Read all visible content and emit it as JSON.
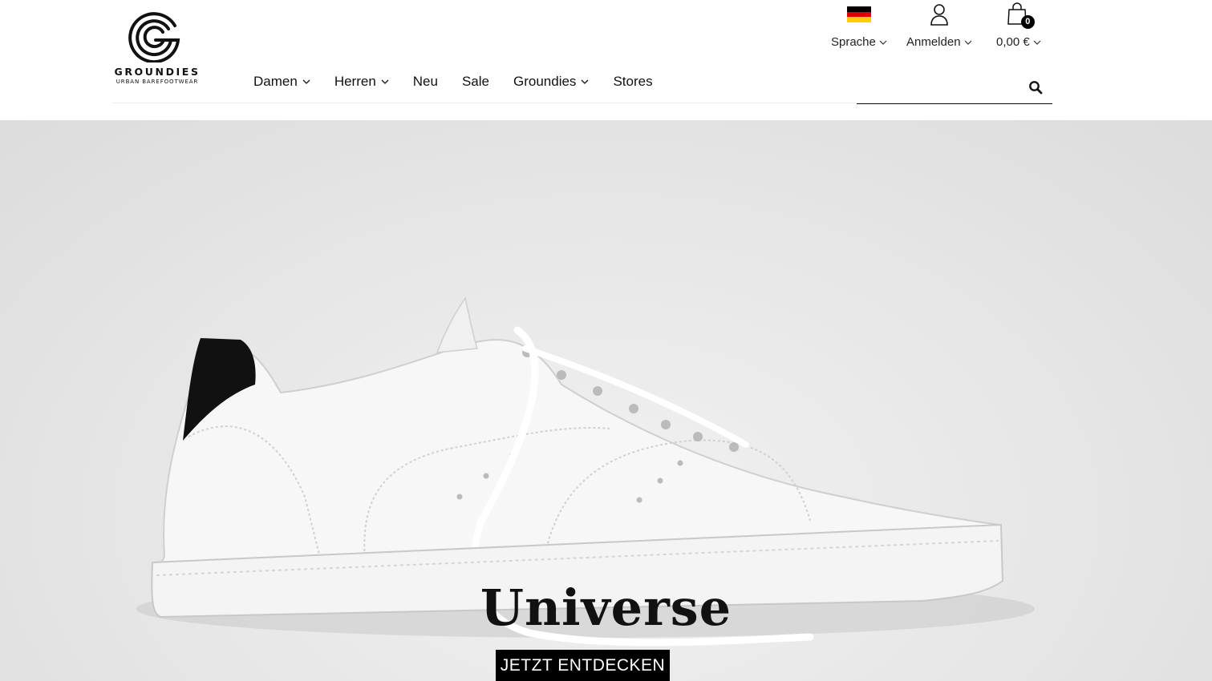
{
  "brand": {
    "name": "GROUNDIES",
    "tagline": "URBAN BAREFOOTWEAR"
  },
  "nav": {
    "items": [
      {
        "label": "Damen",
        "has_dropdown": true
      },
      {
        "label": "Herren",
        "has_dropdown": true
      },
      {
        "label": "Neu",
        "has_dropdown": false
      },
      {
        "label": "Sale",
        "has_dropdown": false
      },
      {
        "label": "Groundies",
        "has_dropdown": true
      },
      {
        "label": "Stores",
        "has_dropdown": false
      }
    ]
  },
  "utility": {
    "language_label": "Sprache",
    "language_flag": "germany-flag",
    "account_label": "Anmelden",
    "cart_total": "0,00 €",
    "cart_count": "0"
  },
  "search": {
    "placeholder": "",
    "value": ""
  },
  "hero": {
    "title": "Universe",
    "cta_label": "JETZT ENTDECKEN",
    "image": "white-leather-sneaker-photo"
  },
  "colors": {
    "text": "#111111",
    "button_bg": "#000000",
    "button_text": "#ffffff",
    "hero_bg": "#e6e6e6",
    "flag_black": "#000000",
    "flag_red": "#dd0000",
    "flag_gold": "#ffce00"
  }
}
